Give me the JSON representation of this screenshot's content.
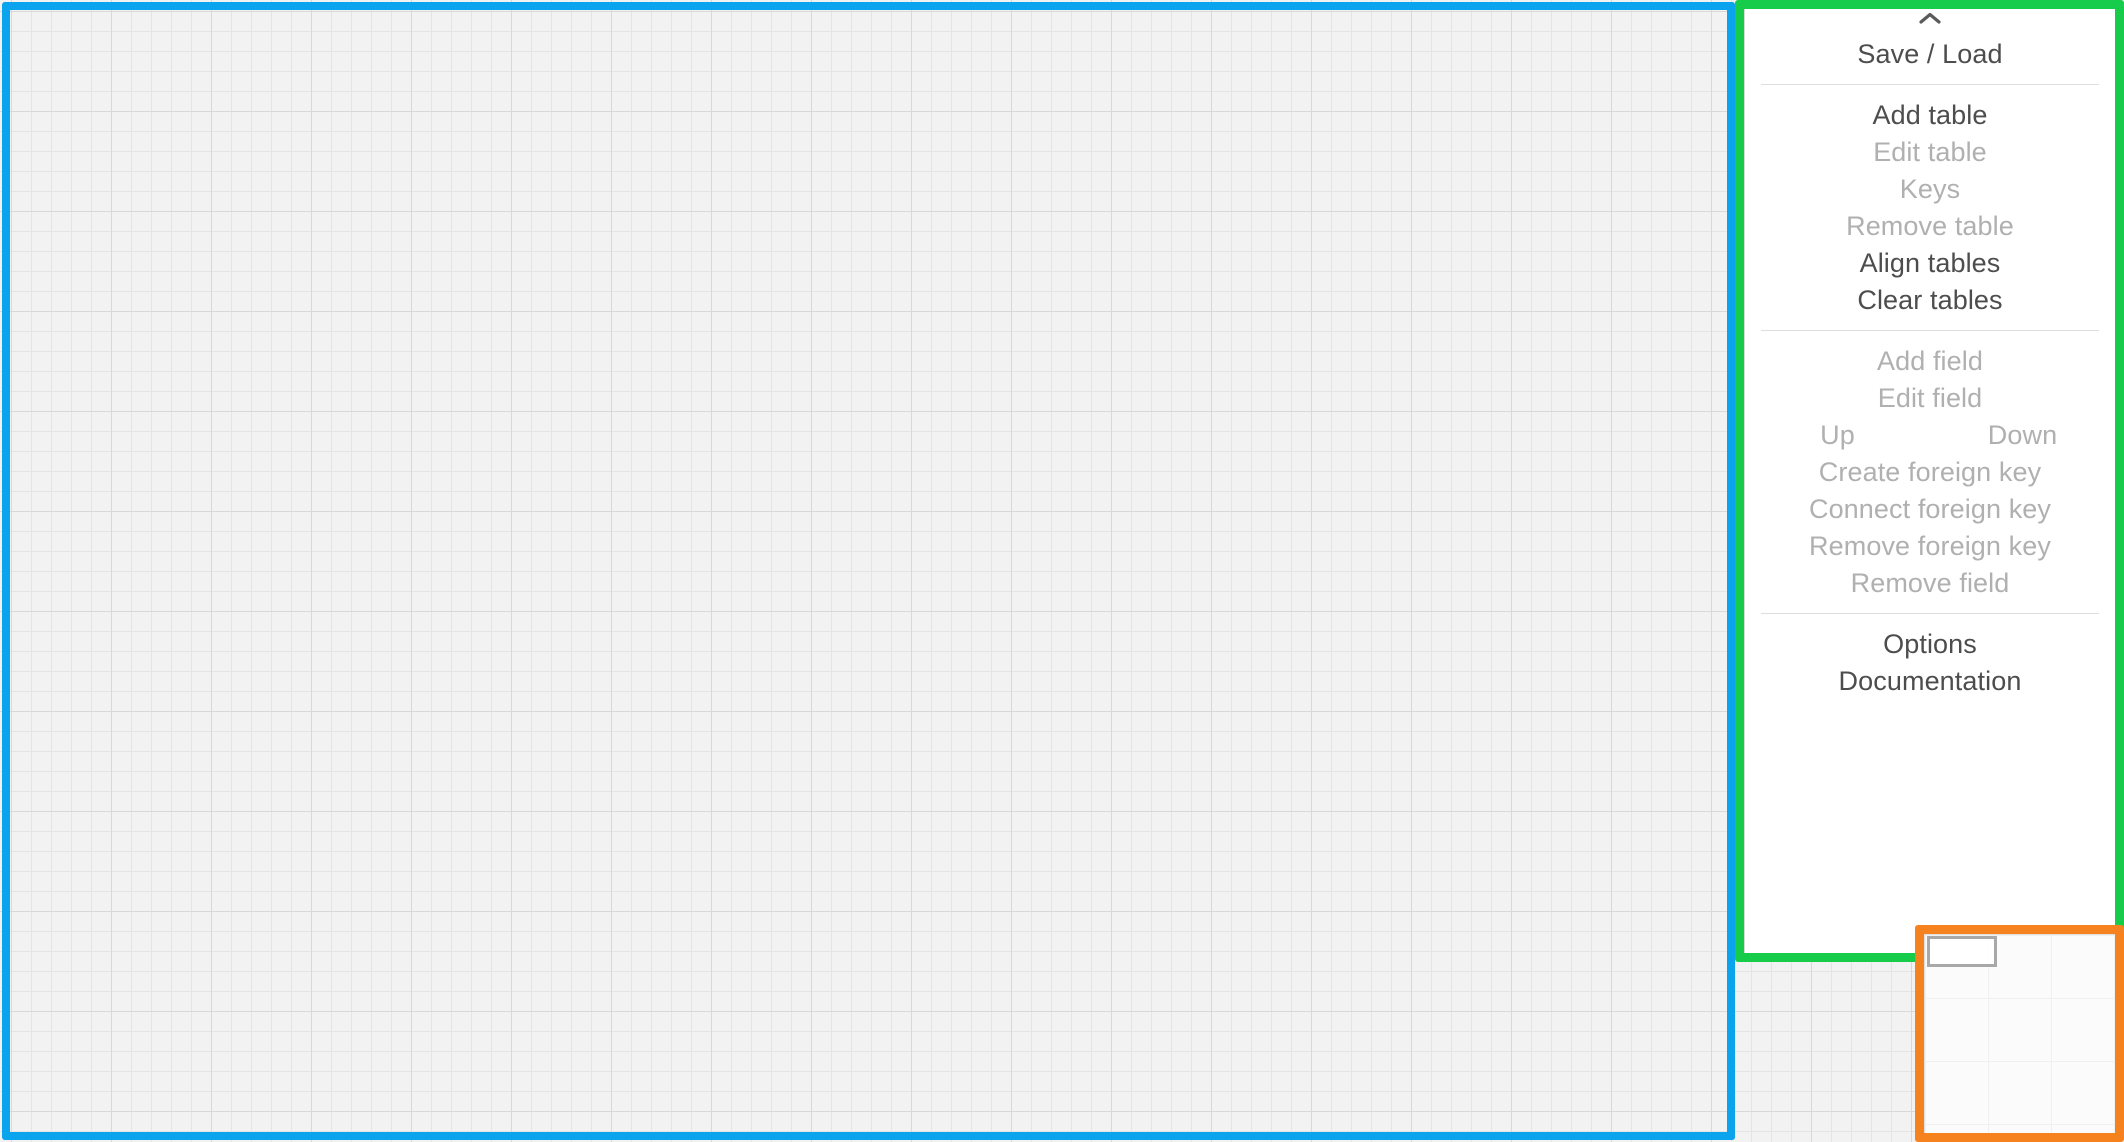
{
  "app": {
    "canvas_label": "diagram-canvas",
    "grid_visible": true
  },
  "colors": {
    "annotation_canvas": "#0aa3ee",
    "annotation_menu": "#17cc4b",
    "annotation_minimap": "#f6821f",
    "menu_background": "#ffffff",
    "text_enabled": "#4d4d4d",
    "text_disabled": "#b0b0b0",
    "separator": "#dedede",
    "grid_minor": "#e4e4e4",
    "grid_major": "#d8d8d8"
  },
  "menu": {
    "collapse_icon": "chevron-up-icon",
    "groups": [
      {
        "name": "file",
        "items": [
          {
            "label": "Save / Load",
            "enabled": true
          }
        ]
      },
      {
        "name": "tables",
        "items": [
          {
            "label": "Add table",
            "enabled": true
          },
          {
            "label": "Edit table",
            "enabled": false
          },
          {
            "label": "Keys",
            "enabled": false
          },
          {
            "label": "Remove table",
            "enabled": false
          },
          {
            "label": "Align tables",
            "enabled": true
          },
          {
            "label": "Clear tables",
            "enabled": true
          }
        ]
      },
      {
        "name": "fields",
        "items": [
          {
            "label": "Add field",
            "enabled": false
          },
          {
            "label": "Edit field",
            "enabled": false
          }
        ],
        "pair": [
          {
            "label": "Up",
            "enabled": false
          },
          {
            "label": "Down",
            "enabled": false
          }
        ],
        "items_after": [
          {
            "label": "Create foreign key",
            "enabled": false
          },
          {
            "label": "Connect foreign key",
            "enabled": false
          },
          {
            "label": "Remove foreign key",
            "enabled": false
          },
          {
            "label": "Remove field",
            "enabled": false
          }
        ]
      },
      {
        "name": "misc",
        "items": [
          {
            "label": "Options",
            "enabled": true
          },
          {
            "label": "Documentation",
            "enabled": true
          }
        ]
      }
    ]
  },
  "minimap": {
    "name": "minimap-panel",
    "viewport_indicator": "viewport-rectangle"
  }
}
